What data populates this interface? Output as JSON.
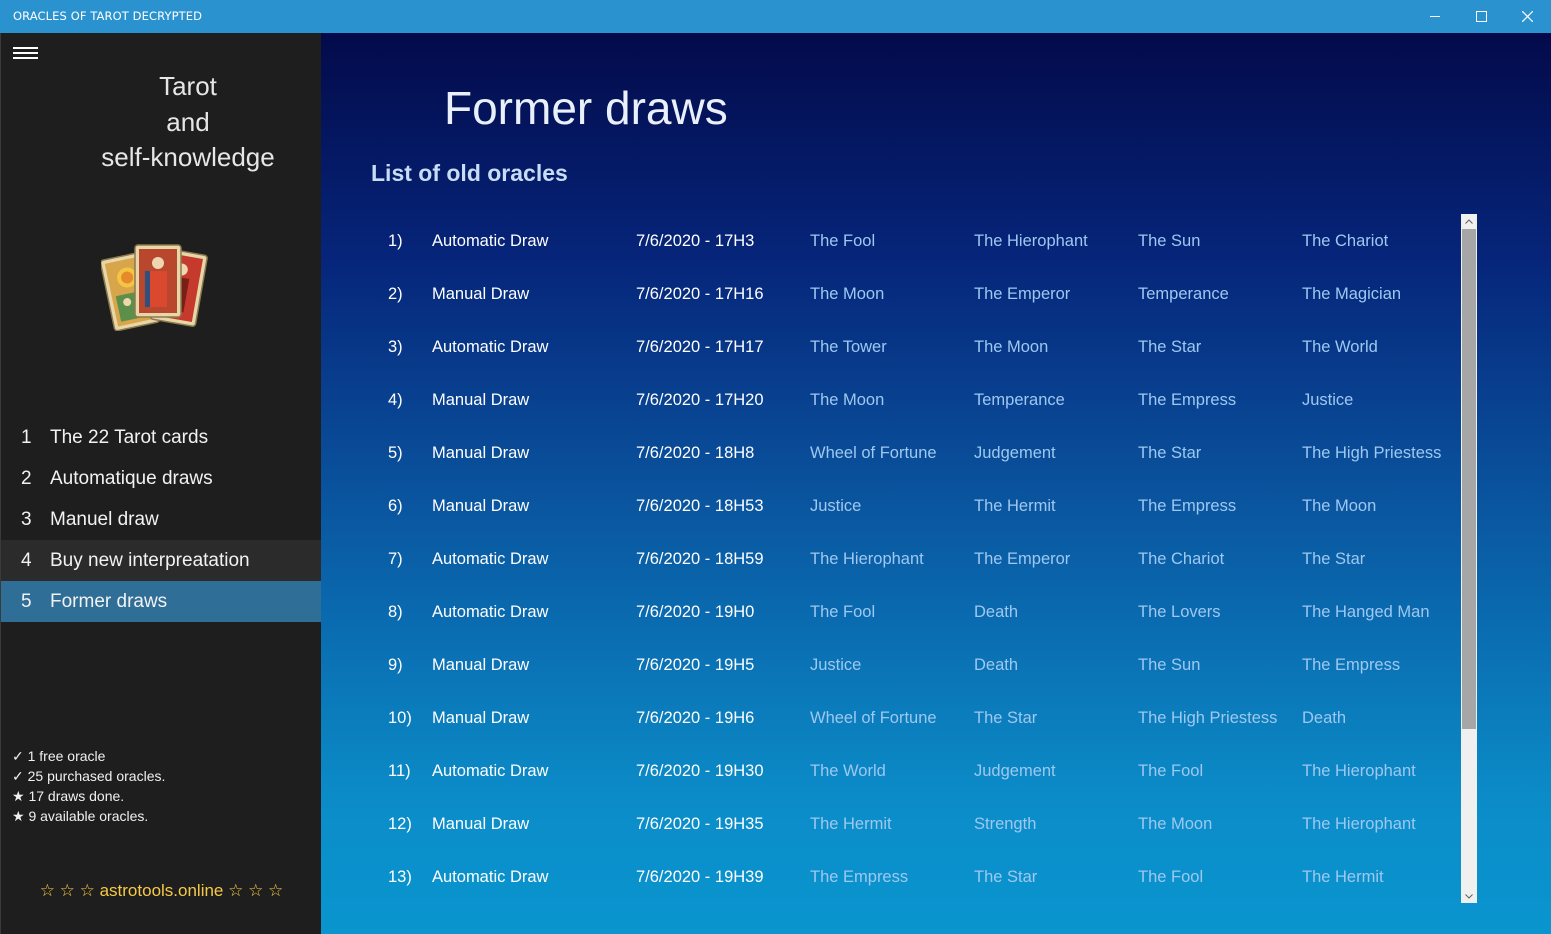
{
  "window": {
    "title": "ORACLES OF TAROT DECRYPTED",
    "minimize_icon": "minimize-icon",
    "maximize_icon": "maximize-icon",
    "close_icon": "close-icon"
  },
  "sidebar": {
    "brand_line1": "Tarot",
    "brand_line2": "and",
    "brand_line3": "self-knowledge",
    "items": [
      {
        "num": "1",
        "label": "The 22 Tarot cards"
      },
      {
        "num": "2",
        "label": "Automatique draws"
      },
      {
        "num": "3",
        "label": "Manuel draw"
      },
      {
        "num": "4",
        "label": "Buy new interpreatation"
      },
      {
        "num": "5",
        "label": "Former draws"
      }
    ],
    "stats": [
      "✓ 1 free oracle",
      "✓ 25 purchased oracles.",
      "★ 17 draws done.",
      "★ 9 available oracles."
    ],
    "footer": "☆ ☆ ☆ astrotools.online ☆ ☆ ☆"
  },
  "main": {
    "title": "Former draws",
    "section_title": "List of old oracles",
    "rows": [
      {
        "idx": "1)",
        "type": "Automatic Draw",
        "date": "7/6/2020 - 17H3",
        "cards": [
          "The Fool",
          "The Hierophant",
          "The Sun",
          "The Chariot"
        ]
      },
      {
        "idx": "2)",
        "type": "Manual Draw",
        "date": "7/6/2020 - 17H16",
        "cards": [
          "The Moon",
          "The Emperor",
          "Temperance",
          "The Magician"
        ]
      },
      {
        "idx": "3)",
        "type": "Automatic Draw",
        "date": "7/6/2020 - 17H17",
        "cards": [
          "The Tower",
          "The Moon",
          "The Star",
          "The World"
        ]
      },
      {
        "idx": "4)",
        "type": "Manual Draw",
        "date": "7/6/2020 - 17H20",
        "cards": [
          "The Moon",
          "Temperance",
          "The Empress",
          "Justice"
        ]
      },
      {
        "idx": "5)",
        "type": "Manual Draw",
        "date": "7/6/2020 - 18H8",
        "cards": [
          "Wheel of Fortune",
          "Judgement",
          "The Star",
          "The High Priestess"
        ]
      },
      {
        "idx": "6)",
        "type": "Manual Draw",
        "date": "7/6/2020 - 18H53",
        "cards": [
          "Justice",
          "The Hermit",
          "The Empress",
          "The Moon"
        ]
      },
      {
        "idx": "7)",
        "type": "Automatic Draw",
        "date": "7/6/2020 - 18H59",
        "cards": [
          "The Hierophant",
          "The Emperor",
          "The Chariot",
          "The Star"
        ]
      },
      {
        "idx": "8)",
        "type": "Automatic Draw",
        "date": "7/6/2020 - 19H0",
        "cards": [
          "The Fool",
          "Death",
          "The Lovers",
          "The Hanged Man"
        ]
      },
      {
        "idx": "9)",
        "type": "Manual Draw",
        "date": "7/6/2020 - 19H5",
        "cards": [
          "Justice",
          "Death",
          "The Sun",
          "The Empress"
        ]
      },
      {
        "idx": "10)",
        "type": "Manual Draw",
        "date": "7/6/2020 - 19H6",
        "cards": [
          "Wheel of Fortune",
          "The Star",
          "The High Priestess",
          "Death"
        ]
      },
      {
        "idx": "11)",
        "type": "Automatic Draw",
        "date": "7/6/2020 - 19H30",
        "cards": [
          "The World",
          "Judgement",
          "The Fool",
          "The Hierophant"
        ]
      },
      {
        "idx": "12)",
        "type": "Manual Draw",
        "date": "7/6/2020 - 19H35",
        "cards": [
          "The Hermit",
          "Strength",
          "The Moon",
          "The Hierophant"
        ]
      },
      {
        "idx": "13)",
        "type": "Automatic Draw",
        "date": "7/6/2020 - 19H39",
        "cards": [
          "The Empress",
          "The Star",
          "The Fool",
          "The Hermit"
        ]
      }
    ]
  },
  "colors": {
    "titlebar": "#2a93cf",
    "active_item": "#2f6e96",
    "card_text": "#9ec8f0",
    "footer_link": "#f7c948"
  }
}
